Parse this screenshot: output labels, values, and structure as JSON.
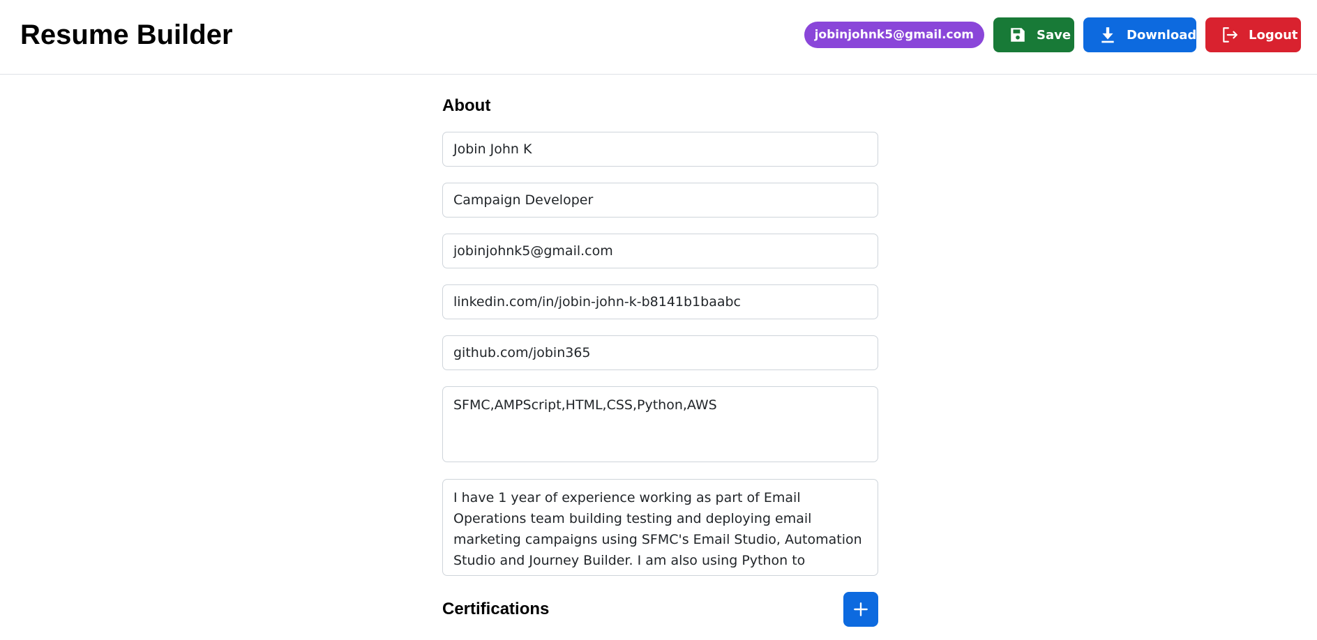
{
  "header": {
    "title": "Resume Builder",
    "user_email": "jobinjohnk5@gmail.com",
    "save_label": "Save",
    "download_label": "Download",
    "logout_label": "Logout"
  },
  "about": {
    "heading": "About",
    "name": "Jobin John K",
    "role": "Campaign Developer",
    "email": "jobinjohnk5@gmail.com",
    "linkedin": "linkedin.com/in/jobin-john-k-b8141b1baabc",
    "github": "github.com/jobin365",
    "skills": "SFMC,AMPScript,HTML,CSS,Python,AWS",
    "summary": "I have 1 year of experience working as part of Email Operations team building testing and deploying email marketing campaigns using SFMC's Email Studio, Automation Studio and Journey Builder. I am also using Python to automate some of the repetitive tasks."
  },
  "certifications": {
    "heading": "Certifications"
  },
  "icons": {
    "save": "floppy-disk-icon",
    "download": "download-icon",
    "logout": "logout-icon",
    "add": "plus-icon"
  },
  "colors": {
    "badge": "#8a46d9",
    "save": "#187a37",
    "download": "#0d6adf",
    "logout": "#d9222f",
    "add": "#0d6adf"
  }
}
